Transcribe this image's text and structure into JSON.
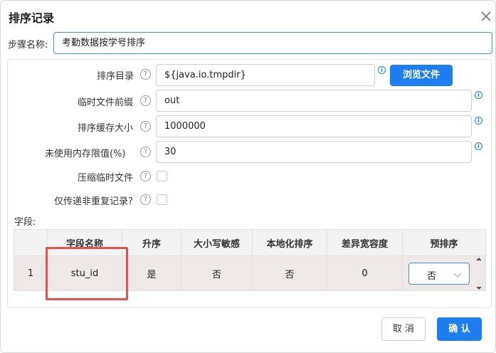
{
  "dialog": {
    "title": "排序记录",
    "close_icon": "close-icon"
  },
  "step": {
    "label": "步骤名称:",
    "value": "考勤数据按学号排序"
  },
  "form": {
    "sort_dir": {
      "label": "排序目录",
      "value": "${java.io.tmpdir}",
      "browse_label": "浏览文件"
    },
    "tmp_prefix": {
      "label": "临时文件前缀",
      "value": "out"
    },
    "sort_buffer": {
      "label": "排序缓存大小",
      "value": "1000000"
    },
    "free_mem": {
      "label": "未使用内存限值(%)",
      "value": "30"
    },
    "compress": {
      "label": "压缩临时文件",
      "checked": false
    },
    "unique_only": {
      "label": "仅传递非重复记录?",
      "checked": false
    },
    "help_glyph": "?",
    "info_glyph": "i"
  },
  "fields": {
    "label": "字段:",
    "columns": [
      "",
      "字段名称",
      "升序",
      "大小写敏感",
      "本地化排序",
      "差异宽容度",
      "预排序"
    ],
    "rows": [
      {
        "num": "1",
        "name": "stu_id",
        "ascending": "是",
        "case_sensitive": "否",
        "collator": "否",
        "tolerance": "0",
        "presorted": "否"
      }
    ]
  },
  "buttons": {
    "cancel": "取 消",
    "ok": "确 认"
  },
  "colors": {
    "primary": "#1e7ef0",
    "highlight": "#e05454"
  }
}
